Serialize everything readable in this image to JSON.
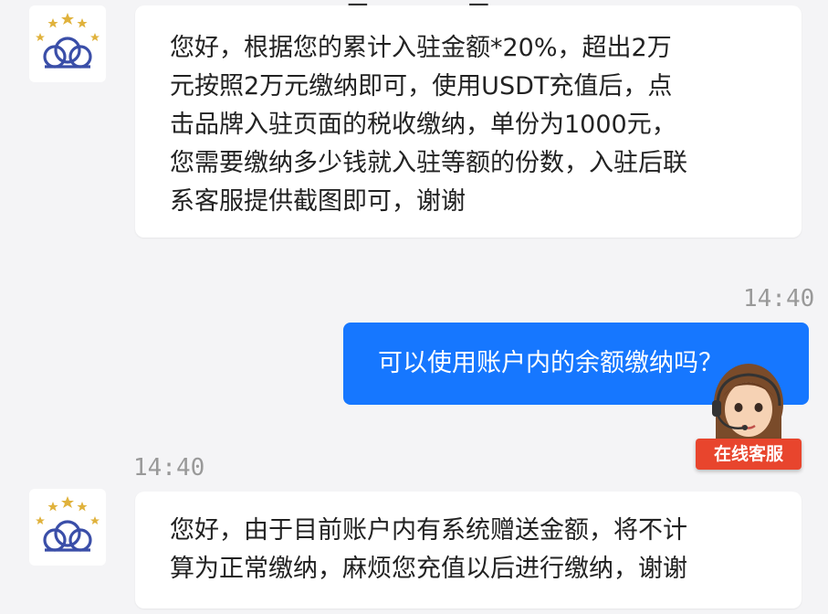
{
  "messages": [
    {
      "direction": "incoming",
      "lines": [
        "您好，根据您的累计入驻金额*20%，超出2万",
        "元按照2万元缴纳即可，使用USDT充值后，点",
        "击品牌入驻页面的税收缴纳，单份为1000元，",
        "您需要缴纳多少钱就入驻等额的份数，入驻后联",
        "系客服提供截图即可，谢谢"
      ]
    },
    {
      "direction": "outgoing",
      "time": "14:40",
      "text": "可以使用账户内的余额缴纳吗？"
    },
    {
      "direction": "incoming",
      "time": "14:40",
      "lines": [
        "您好，由于目前账户内有系统赠送金额，将不计",
        "算为正常缴纳，麻烦您充值以后进行缴纳，谢谢"
      ]
    }
  ],
  "support_widget": {
    "label": "在线客服"
  },
  "colors": {
    "background": "#f4f4f6",
    "outgoing_bubble": "#1677ff",
    "support_badge": "#e8452d",
    "logo_blue": "#3a4ea8",
    "star_gold": "#e0b23c"
  }
}
